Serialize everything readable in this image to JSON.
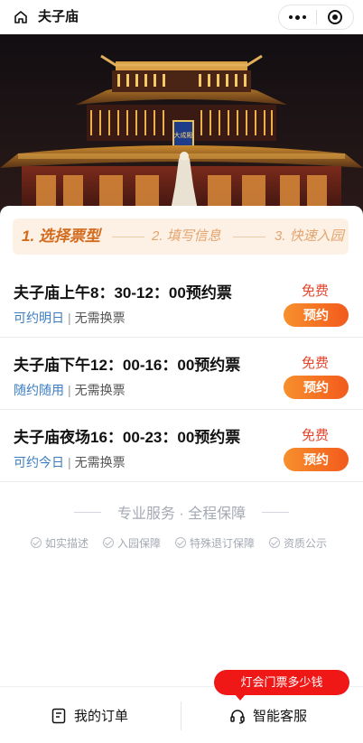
{
  "app": {
    "title": "夫子庙"
  },
  "hero": {
    "plaque_text": "大成殿"
  },
  "steps": [
    {
      "label": "1. 选择票型",
      "active": true
    },
    {
      "label": "2. 填写信息",
      "active": false
    },
    {
      "label": "3. 快速入园",
      "active": false
    }
  ],
  "tickets": [
    {
      "name": "夫子庙上午8：30-12：00预约票",
      "price": "免费",
      "availability": "可约明日",
      "separator": "|",
      "note": "无需换票",
      "button": "预约"
    },
    {
      "name": "夫子庙下午12：00-16：00预约票",
      "price": "免费",
      "availability": "随约随用",
      "separator": "|",
      "note": "无需换票",
      "button": "预约"
    },
    {
      "name": "夫子庙夜场16：00-23：00预约票",
      "price": "免费",
      "availability": "可约今日",
      "separator": "|",
      "note": "无需换票",
      "button": "预约"
    }
  ],
  "service": {
    "title": "专业服务 · 全程保障",
    "items": [
      "如实描述",
      "入园保障",
      "特殊退订保障",
      "资质公示"
    ]
  },
  "bottom": {
    "orders_label": "我的订单",
    "service_label": "智能客服",
    "bubble": "灯会门票多少钱"
  },
  "colors": {
    "accent": "#f25a1c",
    "price": "#e2462e",
    "link": "#3a7dc3",
    "bubble": "#f01717"
  }
}
